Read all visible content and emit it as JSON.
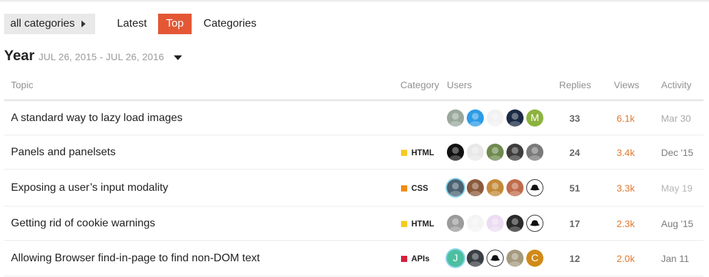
{
  "nav": {
    "category_dropdown": "all categories",
    "tabs": [
      "Latest",
      "Top",
      "Categories"
    ],
    "active_tab": "Top",
    "active_color": "#e45735"
  },
  "period": {
    "title": "Year",
    "range": "JUL 26, 2015 - JUL 26, 2016"
  },
  "table": {
    "headers": {
      "topic": "Topic",
      "category": "Category",
      "users": "Users",
      "replies": "Replies",
      "views": "Views",
      "activity": "Activity"
    },
    "rows": [
      {
        "title": "A standard way to lazy load images",
        "category": "",
        "category_color": "",
        "avatars": [
          {
            "icon": "bald-man-avatar",
            "bg": "#9aa89b",
            "letter": ""
          },
          {
            "icon": "blue-swirl-avatar",
            "bg": "#2d9be6",
            "letter": ""
          },
          {
            "icon": "skull-avatar",
            "bg": "#f2f2f2",
            "letter": ""
          },
          {
            "icon": "dark-face-avatar",
            "bg": "#1b2a44",
            "letter": ""
          },
          {
            "icon": "letter-avatar",
            "bg": "#8cb33e",
            "letter": "M"
          }
        ],
        "replies": "33",
        "views": "6.1k",
        "views_color": "#e0782e",
        "activity": "Mar 30",
        "activity_color": "#a8a8a8"
      },
      {
        "title": "Panels and panelsets",
        "category": "HTML",
        "category_color": "#f7c924",
        "avatars": [
          {
            "icon": "tink-logo-avatar",
            "bg": "#111111",
            "letter": ""
          },
          {
            "icon": "sketch-avatar",
            "bg": "#e8e8e8",
            "letter": ""
          },
          {
            "icon": "cartoon-avatar",
            "bg": "#6e8a4f",
            "letter": ""
          },
          {
            "icon": "bw-portrait-avatar",
            "bg": "#3d3d3d",
            "letter": ""
          },
          {
            "icon": "grey-portrait-avatar",
            "bg": "#7a7a7a",
            "letter": ""
          }
        ],
        "replies": "24",
        "views": "3.4k",
        "views_color": "#e0782e",
        "activity": "Dec '15",
        "activity_color": "#7a7a7a"
      },
      {
        "title": "Exposing a user’s input modality",
        "category": "CSS",
        "category_color": "#f28b10",
        "avatars": [
          {
            "icon": "hat-man-avatar",
            "bg": "#4a6272",
            "letter": ""
          },
          {
            "icon": "portrait-avatar",
            "bg": "#8b5a3c",
            "letter": ""
          },
          {
            "icon": "dog-avatar",
            "bg": "#c48a3a",
            "letter": ""
          },
          {
            "icon": "redhead-avatar",
            "bg": "#c06b4c",
            "letter": ""
          },
          {
            "icon": "fedora-avatar",
            "bg": "#ffffff",
            "letter": ""
          }
        ],
        "replies": "51",
        "views": "3.3k",
        "views_color": "#e0782e",
        "activity": "May 19",
        "activity_color": "#b5b5b5"
      },
      {
        "title": "Getting rid of cookie warnings",
        "category": "HTML",
        "category_color": "#f7c924",
        "avatars": [
          {
            "icon": "bw-face-avatar",
            "bg": "#9b9b9b",
            "letter": ""
          },
          {
            "icon": "dog-sketch-avatar",
            "bg": "#f4f4f4",
            "letter": ""
          },
          {
            "icon": "purple-doodle-avatar",
            "bg": "#ecdcf3",
            "letter": ""
          },
          {
            "icon": "mono-portrait-avatar",
            "bg": "#2a2a2a",
            "letter": ""
          },
          {
            "icon": "fedora-avatar",
            "bg": "#ffffff",
            "letter": ""
          }
        ],
        "replies": "17",
        "views": "2.3k",
        "views_color": "#e0782e",
        "activity": "Aug '15",
        "activity_color": "#7a7a7a"
      },
      {
        "title": "Allowing Browser find-in-page to find non-DOM text",
        "category": "APIs",
        "category_color": "#d4213d",
        "avatars": [
          {
            "icon": "letter-avatar",
            "bg": "#4cbfa0",
            "letter": "J"
          },
          {
            "icon": "bearded-man-avatar",
            "bg": "#3a3f45",
            "letter": ""
          },
          {
            "icon": "fedora-avatar",
            "bg": "#ffffff",
            "letter": ""
          },
          {
            "icon": "old-photo-avatar",
            "bg": "#a59a7e",
            "letter": ""
          },
          {
            "icon": "letter-avatar",
            "bg": "#d08a1a",
            "letter": "C"
          }
        ],
        "replies": "12",
        "views": "2.0k",
        "views_color": "#e0782e",
        "activity": "Jan 11",
        "activity_color": "#7a7a7a"
      }
    ]
  }
}
